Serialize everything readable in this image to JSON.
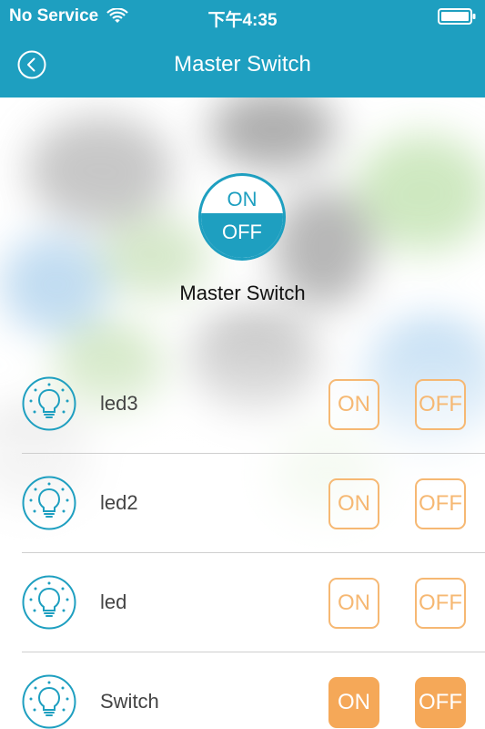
{
  "status_bar": {
    "carrier": "No Service",
    "time": "下午4:35",
    "icons": [
      "wifi-icon",
      "battery-icon"
    ]
  },
  "nav": {
    "title": "Master Switch",
    "back_icon": "chevron-left-icon"
  },
  "master": {
    "on_label": "ON",
    "off_label": "OFF",
    "label": "Master Switch"
  },
  "devices": [
    {
      "name": "led3",
      "on_label": "ON",
      "off_label": "OFF",
      "icon": "bulb-icon",
      "filled": false
    },
    {
      "name": "led2",
      "on_label": "ON",
      "off_label": "OFF",
      "icon": "bulb-icon",
      "filled": false
    },
    {
      "name": "led",
      "on_label": "ON",
      "off_label": "OFF",
      "icon": "bulb-icon",
      "filled": false
    },
    {
      "name": "Switch",
      "on_label": "ON",
      "off_label": "OFF",
      "icon": "bulb-icon",
      "filled": true
    }
  ],
  "colors": {
    "primary": "#1e9fc0",
    "accent": "#f6b873",
    "accent_filled": "#f5a858"
  }
}
